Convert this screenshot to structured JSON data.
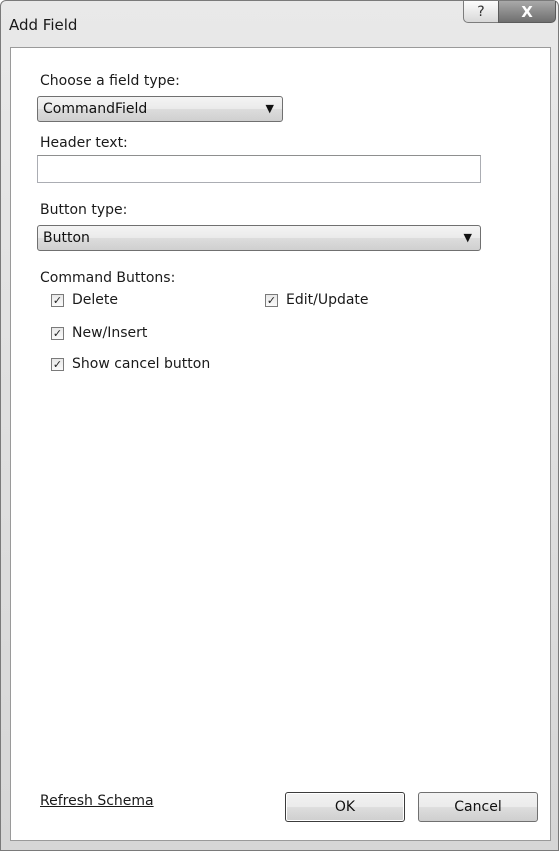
{
  "window": {
    "title": "Add Field",
    "help_glyph": "?",
    "close_glyph": "X"
  },
  "field_type": {
    "label": "Choose a field type:",
    "value": "CommandField"
  },
  "header_text": {
    "label": "Header text:",
    "value": ""
  },
  "button_type": {
    "label": "Button type:",
    "value": "Button"
  },
  "command_buttons": {
    "label": "Command Buttons:",
    "items": [
      {
        "label": "Delete",
        "checked": true
      },
      {
        "label": "Edit/Update",
        "checked": true
      },
      {
        "label": "New/Insert",
        "checked": true
      },
      {
        "label": "Show cancel button",
        "checked": true
      }
    ],
    "check_glyph": "✓",
    "arrow_glyph": "▼"
  },
  "footer": {
    "refresh_link": "Refresh Schema",
    "ok_label": "OK",
    "cancel_label": "Cancel"
  }
}
